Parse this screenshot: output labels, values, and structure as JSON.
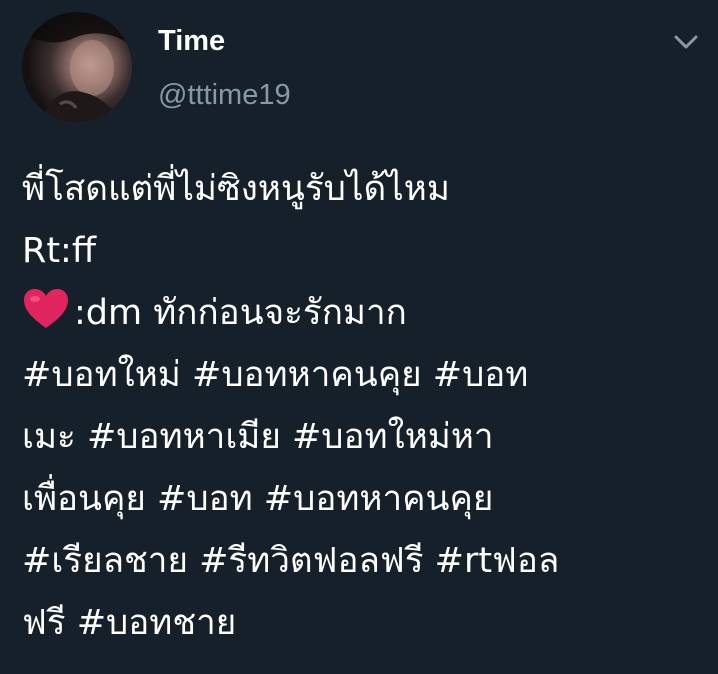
{
  "tweet": {
    "author": {
      "display_name": "Time",
      "handle": "@tttime19"
    },
    "menu_icon": "chevron-down-icon",
    "body": {
      "line1": "พี่โสดแต่พี่ไม่ซิงหนูรับได้ไหม",
      "line2": "Rt:ff",
      "line3_icon": "heart-emoji",
      "line3_text": ":dm ทักก่อนจะรักมาก",
      "line4": "#บอทใหม่ #บอทหาคนคุย #บอท",
      "line5": "เมะ  #บอทหาเมีย #บอทใหม่หา",
      "line6": "เพื่อนคุย #บอท #บอทหาคนคุย",
      "line7": "#เรียลชาย #รีทวิตฟอลฟรี #rtฟอล",
      "line8": "ฟรี #บอทชาย"
    }
  },
  "colors": {
    "background": "#15202b",
    "text": "#ffffff",
    "secondary_text": "#8899a6",
    "heart": "#e0245e"
  }
}
